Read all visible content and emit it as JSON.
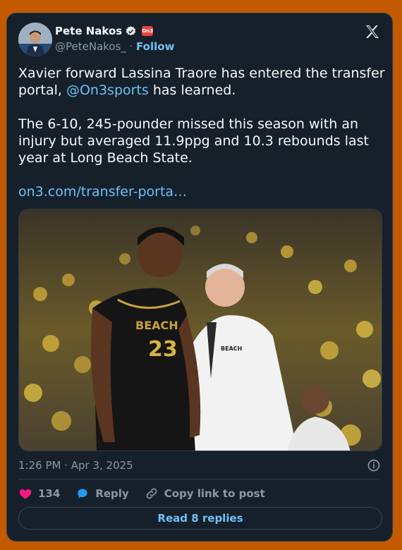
{
  "author": {
    "name": "Pete Nakos",
    "handle": "@PeteNakos_",
    "affiliation_badge": "On3",
    "follow_label": "Follow"
  },
  "tweet": {
    "text_part1": "Xavier forward Lassina Traore has entered the transfer portal, ",
    "mention": "@On3sports",
    "text_part2": " has learned.\n\nThe 6-10, 245-pounder missed this season with an injury but averaged 11.9ppg and 10.3 rebounds last year at Long Beach State.\n\n",
    "link": "on3.com/transfer-porta…"
  },
  "photo": {
    "jersey_number": "23",
    "jersey_text": "BEACH",
    "coach_shirt_text": "BEACH"
  },
  "timestamp": "1:26 PM · Apr 3, 2025",
  "actions": {
    "likes": "134",
    "reply_label": "Reply",
    "copy_label": "Copy link to post"
  },
  "read_replies_label": "Read 8 replies",
  "colors": {
    "background": "#c45a00",
    "card": "#15202b",
    "accent": "#6cc2f5",
    "like": "#f91880"
  }
}
